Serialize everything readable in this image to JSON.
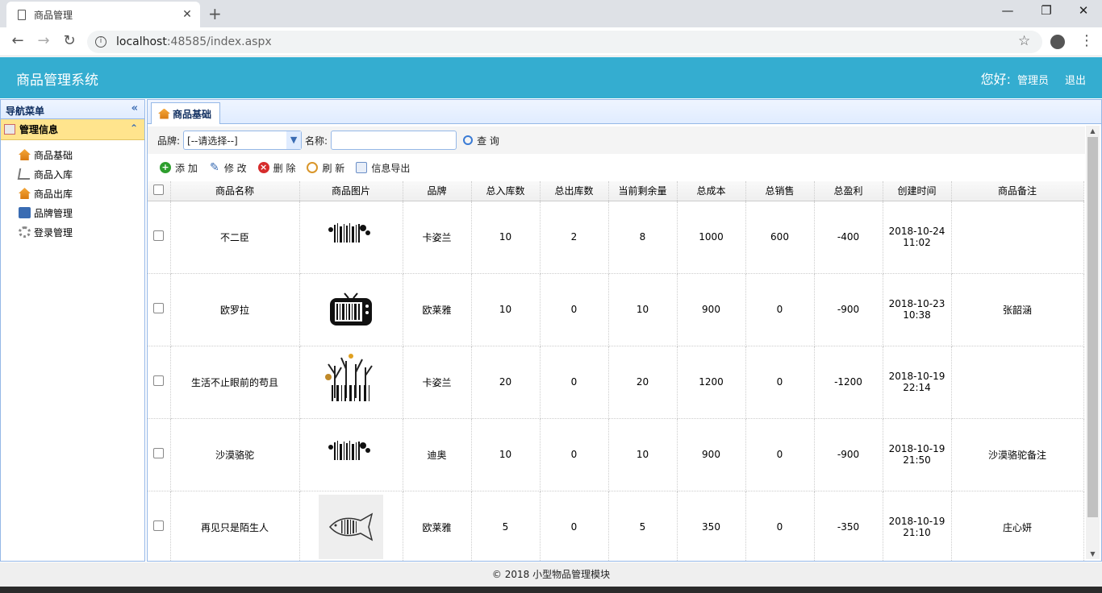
{
  "browser": {
    "tab_title": "商品管理",
    "tab_close": "✕",
    "new_tab": "+",
    "url_host": "localhost",
    "url_rest": ":48585/index.aspx"
  },
  "header": {
    "title": "商品管理系统",
    "greeting": "您好:",
    "user": "管理员",
    "logout": "退出"
  },
  "sidebar": {
    "title": "导航菜单",
    "group": "管理信息",
    "items": [
      {
        "label": "商品基础",
        "icon": "home-icon"
      },
      {
        "label": "商品入库",
        "icon": "cart-icon"
      },
      {
        "label": "商品出库",
        "icon": "home-icon"
      },
      {
        "label": "品牌管理",
        "icon": "book-icon"
      },
      {
        "label": "登录管理",
        "icon": "gear-icon"
      }
    ]
  },
  "main": {
    "tab": "商品基础",
    "filter": {
      "brand_label": "品牌:",
      "brand_value": "[--请选择--]",
      "name_label": "名称:",
      "search": "查 询"
    },
    "actions": {
      "add": "添 加",
      "edit": "修 改",
      "delete": "删 除",
      "refresh": "刷 新",
      "export": "信息导出"
    },
    "columns": [
      "商品名称",
      "商品图片",
      "品牌",
      "总入库数",
      "总出库数",
      "当前剩余量",
      "总成本",
      "总销售",
      "总盈利",
      "创建时间",
      "商品备注"
    ],
    "rows": [
      {
        "name": "不二臣",
        "brand": "卡姿兰",
        "in": "10",
        "out": "2",
        "remain": "8",
        "cost": "1000",
        "sales": "600",
        "profit": "-400",
        "date": "2018-10-24",
        "time": "11:02",
        "note": ""
      },
      {
        "name": "欧罗拉",
        "brand": "欧莱雅",
        "in": "10",
        "out": "0",
        "remain": "10",
        "cost": "900",
        "sales": "0",
        "profit": "-900",
        "date": "2018-10-23",
        "time": "10:38",
        "note": "张韶涵"
      },
      {
        "name": "生活不止眼前的苟且",
        "brand": "卡姿兰",
        "in": "20",
        "out": "0",
        "remain": "20",
        "cost": "1200",
        "sales": "0",
        "profit": "-1200",
        "date": "2018-10-19",
        "time": "22:14",
        "note": ""
      },
      {
        "name": "沙漠骆驼",
        "brand": "迪奥",
        "in": "10",
        "out": "0",
        "remain": "10",
        "cost": "900",
        "sales": "0",
        "profit": "-900",
        "date": "2018-10-19",
        "time": "21:50",
        "note": "沙漠骆驼备注"
      },
      {
        "name": "再见只是陌生人",
        "brand": "欧莱雅",
        "in": "5",
        "out": "0",
        "remain": "5",
        "cost": "350",
        "sales": "0",
        "profit": "-350",
        "date": "2018-10-19",
        "time": "21:10",
        "note": "庄心妍"
      }
    ]
  },
  "footer": "© 2018 小型物品管理模块"
}
